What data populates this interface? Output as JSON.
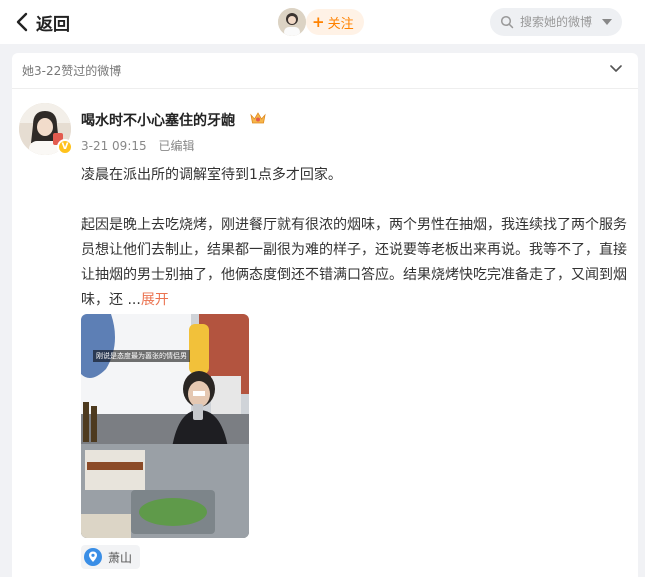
{
  "header": {
    "back_label": "返回",
    "follow_label": "关注",
    "search_placeholder": "搜索她的微博"
  },
  "liked": {
    "text": "她3-22赞过的微博"
  },
  "post": {
    "username": "喝水时不小心塞住的牙龅",
    "date": "3-21 09:15",
    "edited": "已编辑",
    "paragraph1": "凌晨在派出所的调解室待到1点多才回家。",
    "paragraph2": "起因是晚上去吃烧烤，刚进餐厅就有很浓的烟味，两个男性在抽烟，我连续找了两个服务员想让他们去制止，结果都一副很为难的样子，还说要等老板出来再说。我等不了，直接让抽烟的男士别抽了，他俩态度倒还不错满口答应。结果烧烤快吃完准备走了，又闻到烟味，还 ...",
    "expand_label": "展开",
    "image_caption": "刚说是态度最为嚣张的情侣男",
    "location": "萧山"
  },
  "colors": {
    "accent_orange": "#ff8200",
    "expand_link": "#eb7350",
    "verified_badge": "#ffc21c",
    "location_pin": "#3a8ee6"
  },
  "icons": [
    "back-arrow-icon",
    "search-icon",
    "dropdown-caret-icon",
    "chevron-down-icon",
    "crown-icon",
    "verified-icon",
    "location-pin-icon"
  ]
}
